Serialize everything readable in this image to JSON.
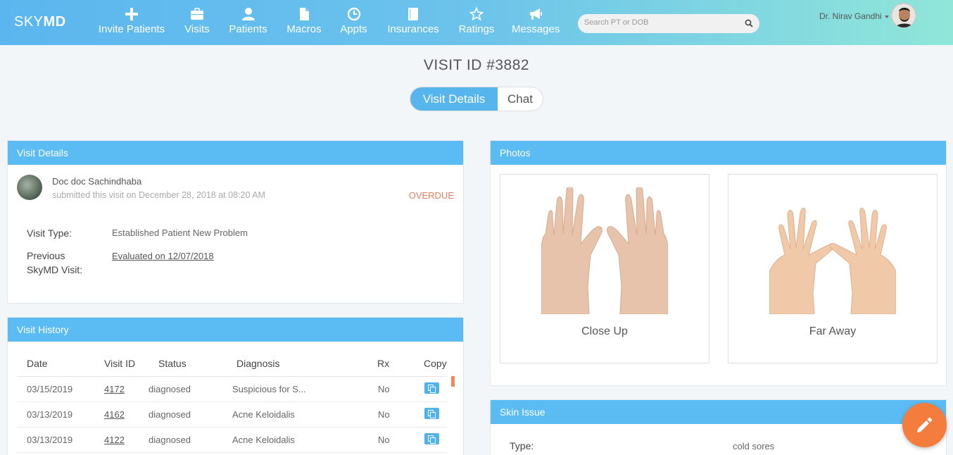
{
  "brand": {
    "sky": "SKY",
    "md": "MD"
  },
  "nav": [
    {
      "label": "Invite Patients",
      "icon": "plus-icon"
    },
    {
      "label": "Visits",
      "icon": "briefcase-icon"
    },
    {
      "label": "Patients",
      "icon": "person-icon"
    },
    {
      "label": "Macros",
      "icon": "file-icon"
    },
    {
      "label": "Appts",
      "icon": "clock-icon"
    },
    {
      "label": "Insurances",
      "icon": "book-icon"
    },
    {
      "label": "Ratings",
      "icon": "star-icon"
    },
    {
      "label": "Messages",
      "icon": "megaphone-icon"
    }
  ],
  "search": {
    "placeholder": "Search PT or DOB"
  },
  "user": {
    "name": "Dr. Nirav Gandhi"
  },
  "page": {
    "title": "VISIT ID #3882"
  },
  "tabs": {
    "details": "Visit Details",
    "chat": "Chat"
  },
  "visit_details": {
    "heading": "Visit Details",
    "submitter": "Doc doc Sachindhaba",
    "submitted": "submitted this visit on December 28, 2018 at 08:20 AM",
    "status": "OVERDUE",
    "type_label": "Visit Type:",
    "type_value": "Established Patient New Problem",
    "prev_label_1": "Previous",
    "prev_label_2": "SkyMD Visit:",
    "prev_value": "Evaluated on 12/07/2018"
  },
  "history": {
    "heading": "Visit History",
    "columns": [
      "Date",
      "Visit ID",
      "Status",
      "Diagnosis",
      "Rx",
      "Copy"
    ],
    "rows": [
      {
        "date": "03/15/2019",
        "id": "4172",
        "status": "diagnosed",
        "diagnosis": "Suspicious for S...",
        "rx": "No"
      },
      {
        "date": "03/13/2019",
        "id": "4162",
        "status": "diagnosed",
        "diagnosis": "Acne Keloidalis",
        "rx": "No"
      },
      {
        "date": "03/13/2019",
        "id": "4122",
        "status": "diagnosed",
        "diagnosis": "Acne Keloidalis",
        "rx": "No"
      }
    ]
  },
  "photos": {
    "heading": "Photos",
    "close_up": "Close Up",
    "far_away": "Far Away"
  },
  "skin_issue": {
    "heading": "Skin Issue",
    "type_label": "Type:",
    "type_value": "cold sores"
  }
}
